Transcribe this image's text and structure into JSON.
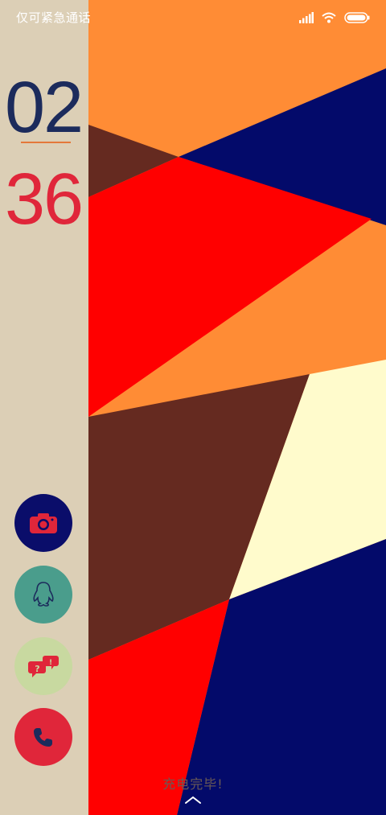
{
  "status_bar": {
    "carrier_text": "仅可紧急通话",
    "icons": [
      "signal-icon",
      "wifi-icon",
      "battery-icon"
    ]
  },
  "clock": {
    "hours": "02",
    "minutes": "36"
  },
  "shortcuts": [
    {
      "name": "camera",
      "icon": "camera-icon",
      "bg": "#0a0d6a"
    },
    {
      "name": "qq",
      "icon": "qq-penguin-icon",
      "bg": "#4a9d8c"
    },
    {
      "name": "feedback",
      "icon": "chat-bubbles-icon",
      "bg": "#c8d9a0"
    },
    {
      "name": "phone",
      "icon": "phone-icon",
      "bg": "#e0263a"
    }
  ],
  "charging_status": "充电完毕!",
  "colors": {
    "sidebar": "#dccfb6",
    "orange": "#ff8c35",
    "navy": "#030a6a",
    "red": "#ff0000",
    "brown": "#652a20",
    "cream": "#fffbcc",
    "hours_color": "#1c2b5c",
    "minutes_color": "#e0263a"
  }
}
